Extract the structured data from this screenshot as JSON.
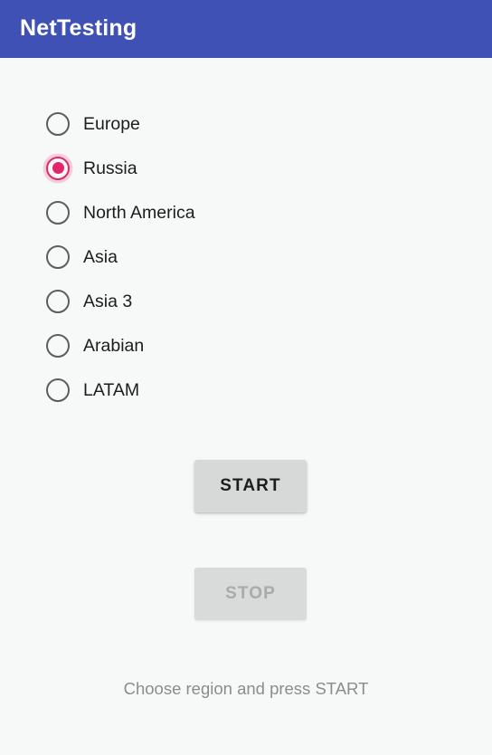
{
  "app_bar": {
    "title": "NetTesting",
    "background_color": "#3f51b5",
    "title_color": "#ffffff"
  },
  "screen": {
    "background_color": "#f7f8f8"
  },
  "region_group": {
    "selected_value": "Russia",
    "selected_color": "#e5256b",
    "unselected_color": "#5d5d5d",
    "options": [
      {
        "label": "Europe",
        "selected": false
      },
      {
        "label": "Russia",
        "selected": true
      },
      {
        "label": "North America",
        "selected": false
      },
      {
        "label": "Asia",
        "selected": false
      },
      {
        "label": "Asia 3",
        "selected": false
      },
      {
        "label": "Arabian",
        "selected": false
      },
      {
        "label": "LATAM",
        "selected": false
      }
    ]
  },
  "buttons": {
    "start": {
      "label": "START",
      "enabled": true,
      "background_color": "#d7d8d8",
      "text_color": "#1d1d1d"
    },
    "stop": {
      "label": "STOP",
      "enabled": false,
      "background_color": "#d9dada",
      "text_color": "#a9aaaa"
    }
  },
  "status": {
    "message": "Choose region and press START",
    "color": "#8b8c8c"
  }
}
